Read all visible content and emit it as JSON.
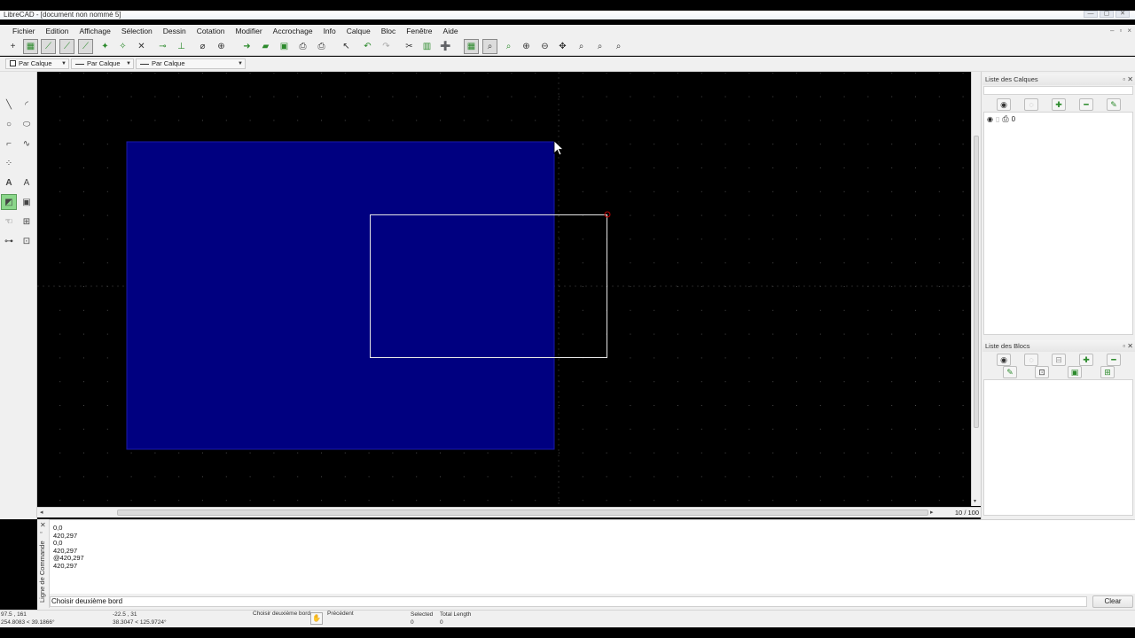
{
  "window": {
    "title": "LibreCAD - [document non nommé 5]",
    "controls": [
      "—",
      "▢",
      "✕"
    ]
  },
  "menu": [
    "Fichier",
    "Edition",
    "Affichage",
    "Sélection",
    "Dessin",
    "Cotation",
    "Modifier",
    "Accrochage",
    "Info",
    "Calque",
    "Bloc",
    "Fenêtre",
    "Aide"
  ],
  "mdi_controls": [
    "–",
    "▫",
    "×"
  ],
  "properties": {
    "color": "Par Calque",
    "width": "Par Calque",
    "linetype": "Par Calque"
  },
  "layers_panel": {
    "title": "Liste des Calques",
    "layers": [
      {
        "name": "0"
      }
    ]
  },
  "blocks_panel": {
    "title": "Liste des Blocs"
  },
  "scroll": {
    "zoom_label": "10 / 100"
  },
  "command": {
    "dock_label": "Ligne de Commande",
    "history": [
      "0,0",
      "420,297",
      "0,0",
      "420,297",
      "@420,297",
      "420,297"
    ],
    "prompt": "Choisir deuxième bord",
    "clear_label": "Clear"
  },
  "status": {
    "abs_coord_1": "97.5 , 161",
    "abs_coord_2": "254.8083 < 39.1866°",
    "rel_coord_1": "-22.5 , 31",
    "rel_coord_2": "38.3047 < 125.9724°",
    "mouse_left": "Choisir deuxième bord",
    "mouse_right": "Précédent",
    "selected_label": "Selected",
    "selected_value": "0",
    "length_label": "Total Length",
    "length_value": "0"
  },
  "colors": {
    "filled_rect": "#000080",
    "canvas_bg": "#000000",
    "grid_dot": "#4a4a4a",
    "outline_rect": "#e6e6e6",
    "snap_marker": "#c00000"
  }
}
